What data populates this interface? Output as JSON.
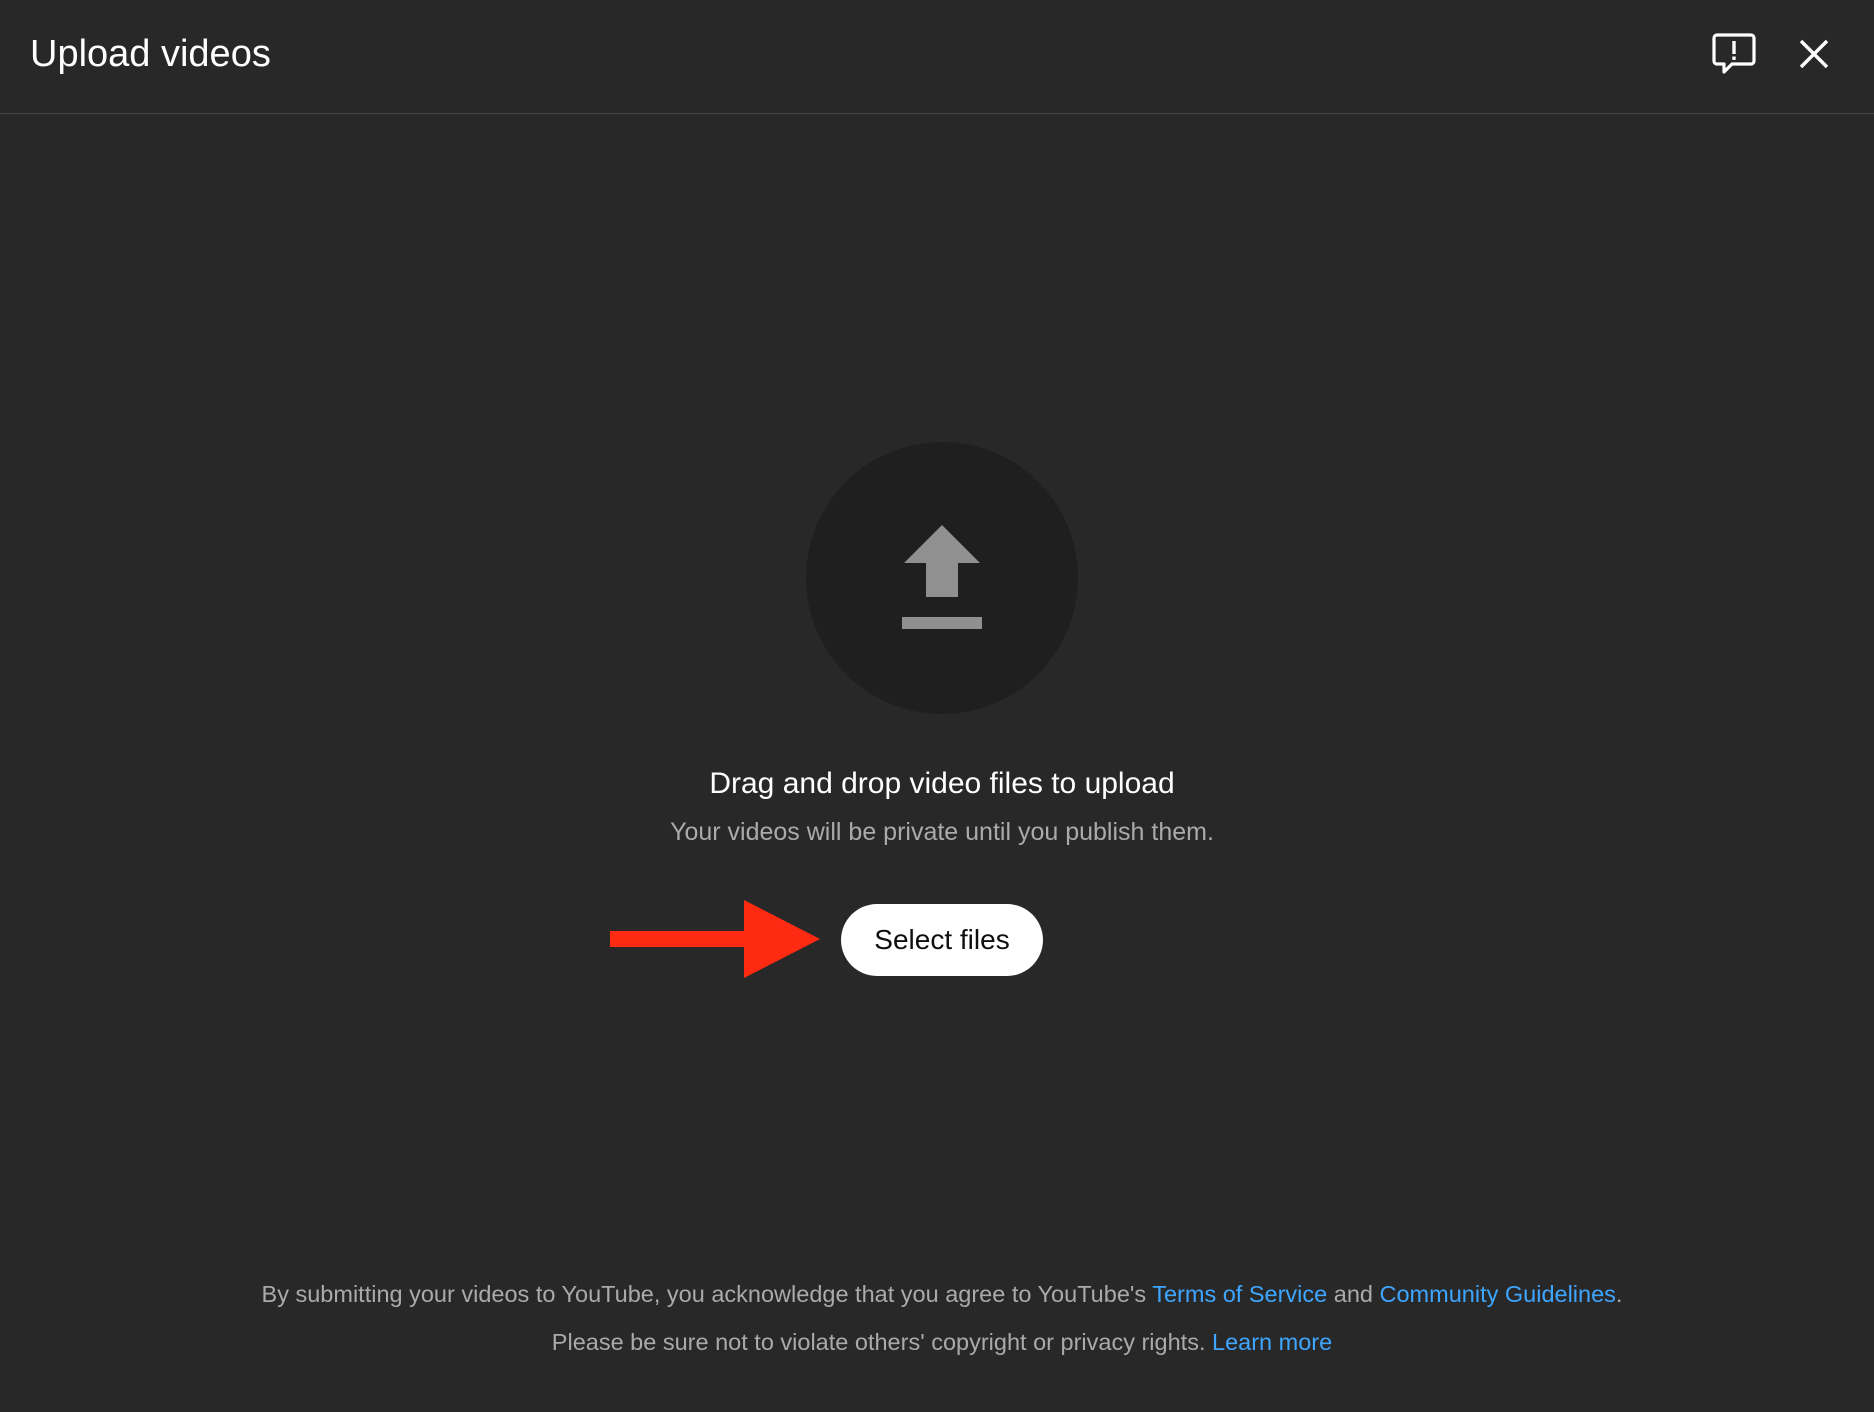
{
  "header": {
    "title": "Upload videos",
    "feedback_icon": "feedback-icon",
    "close_icon": "close-icon"
  },
  "dropzone": {
    "upload_icon": "upload-arrow-icon",
    "primary_text": "Drag and drop video files to upload",
    "secondary_text": "Your videos will be private until you publish them.",
    "select_button_label": "Select files"
  },
  "annotation": {
    "arrow_color": "#ff2a12",
    "icon": "red-arrow-pointer"
  },
  "footer": {
    "line1_prefix": "By submitting your videos to YouTube, you acknowledge that you agree to YouTube's",
    "terms_link": "Terms of Service",
    "and_text": "and",
    "guidelines_link": "Community Guidelines",
    "line1_suffix": ".",
    "line2_text": "Please be sure not to violate others' copyright or privacy rights.",
    "learn_more_link": "Learn more"
  },
  "colors": {
    "background": "#282828",
    "link": "#3ea6ff",
    "secondary_text": "#aaaaaa",
    "button_bg": "#ffffff"
  }
}
